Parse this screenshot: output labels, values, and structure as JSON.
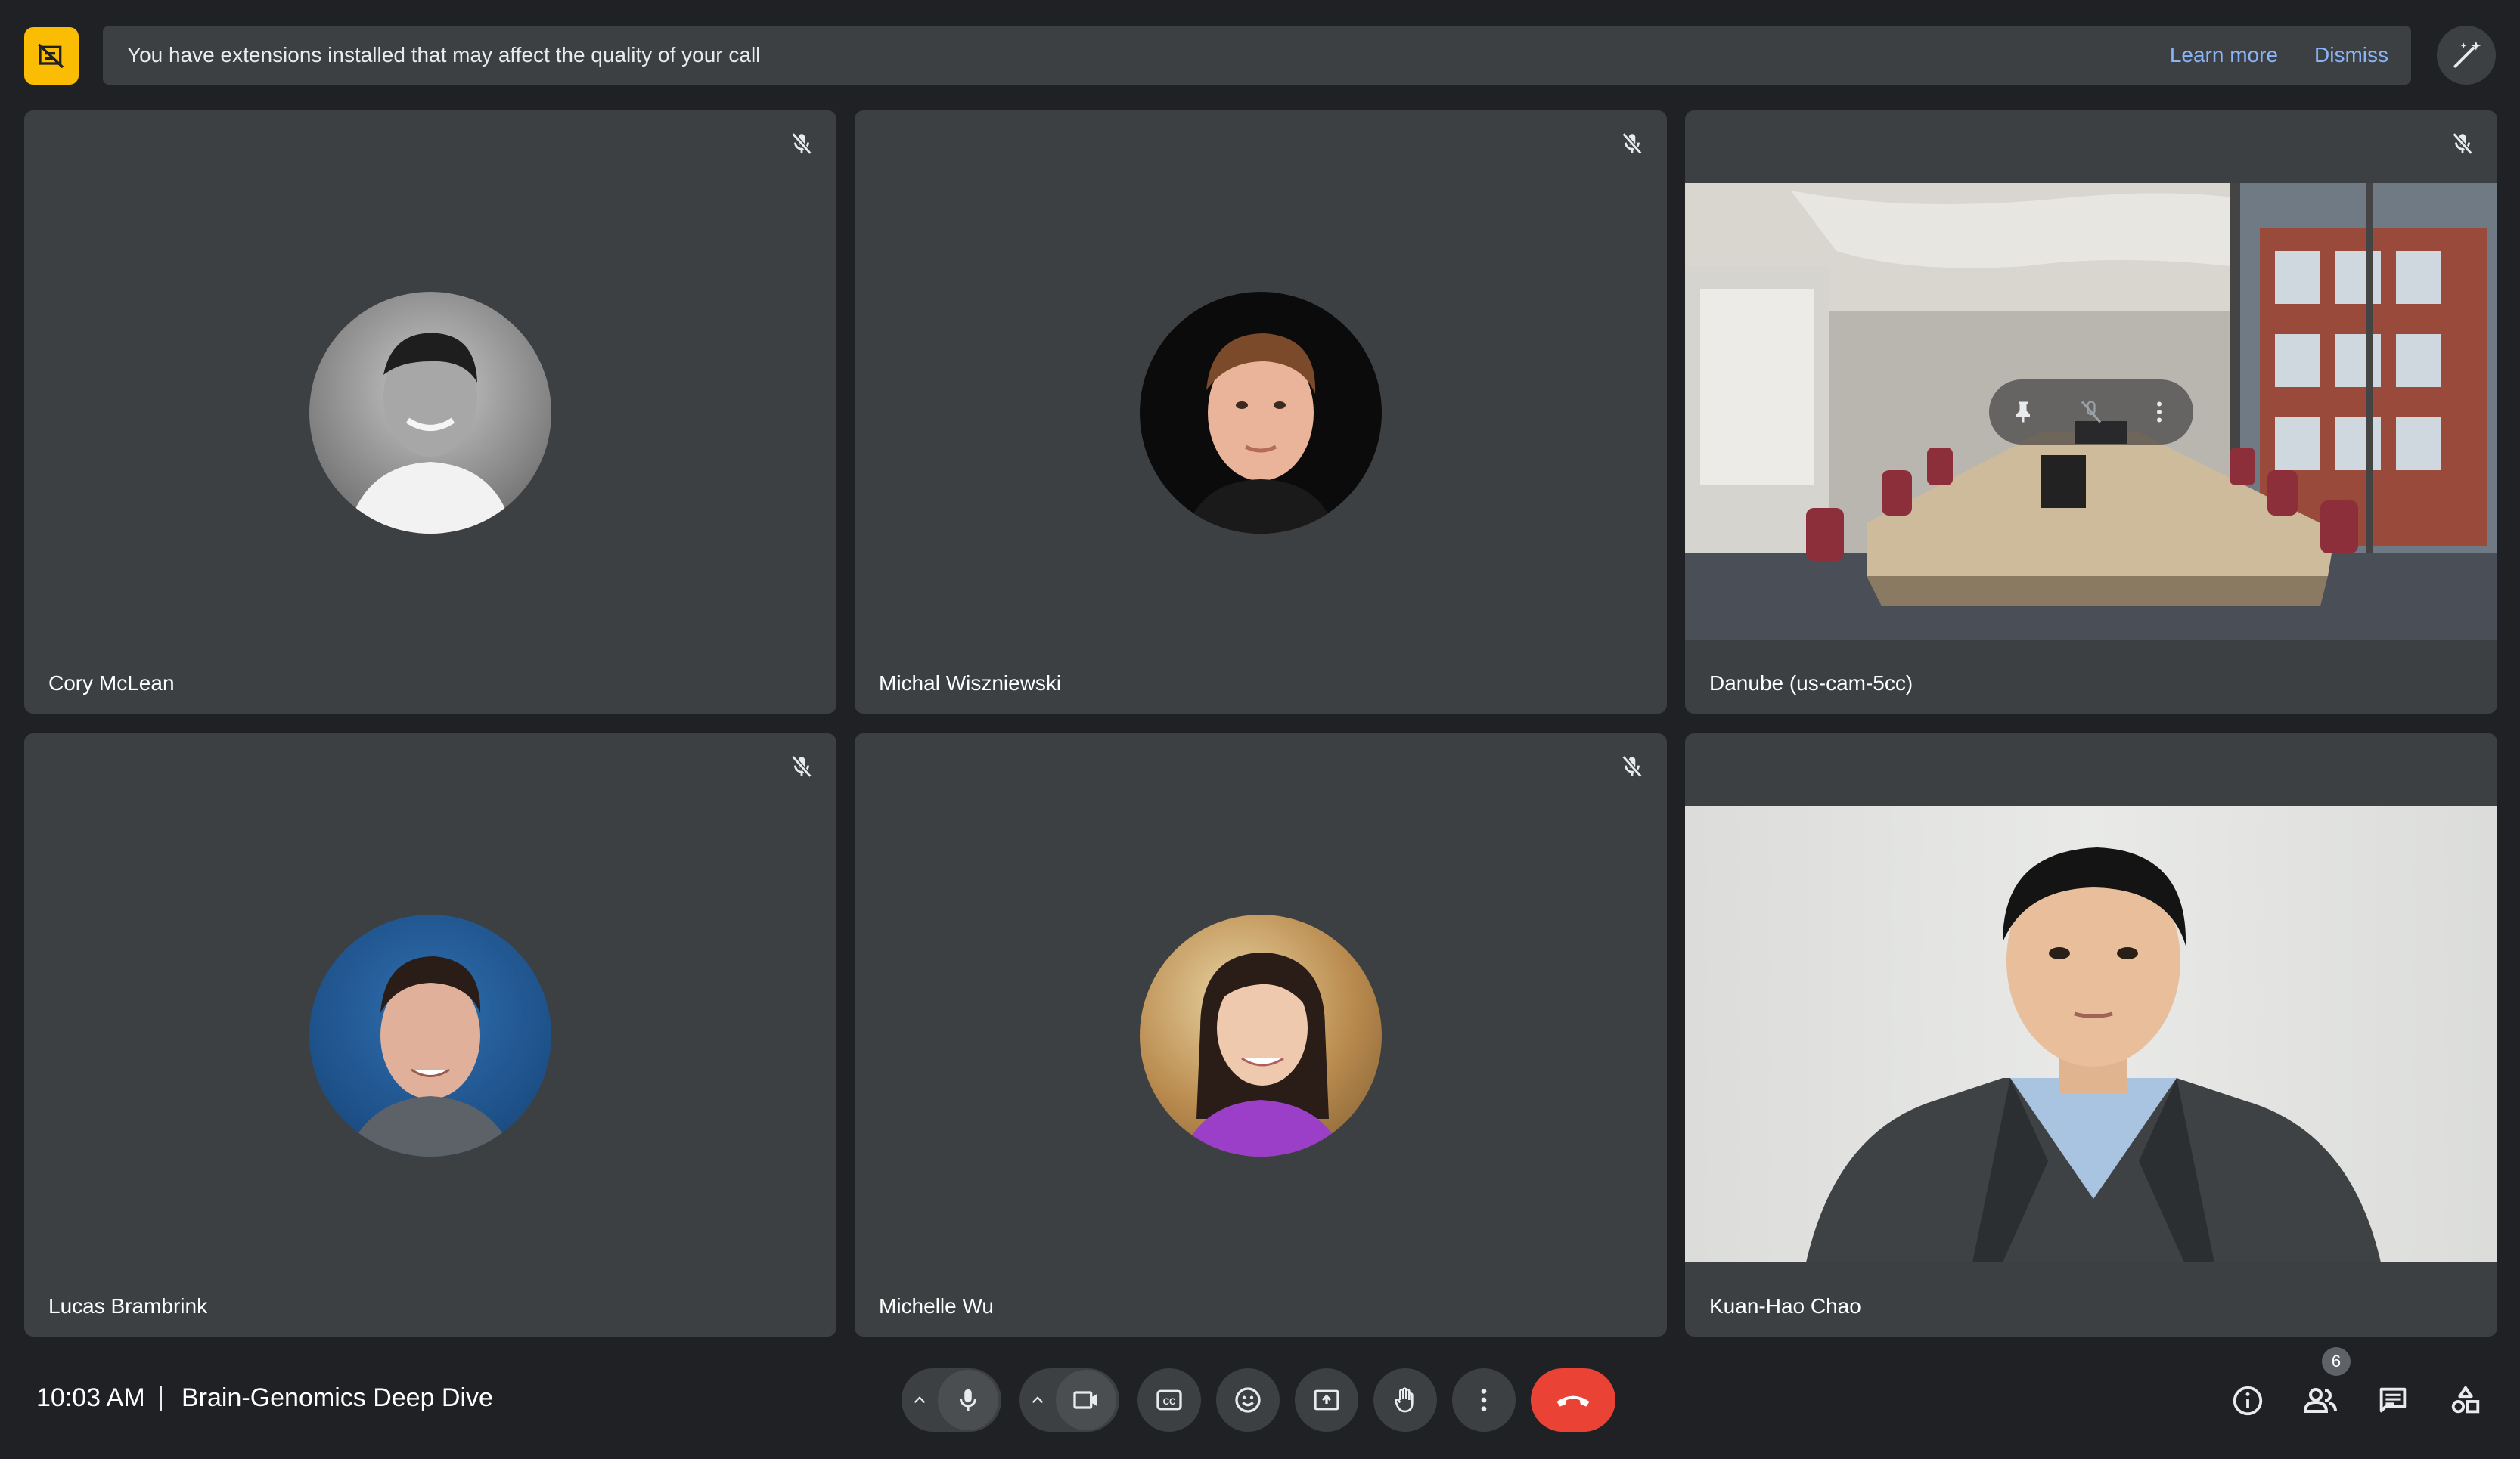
{
  "banner": {
    "icon": "extension-warning-icon",
    "message": "You have extensions installed that may affect the quality of your call",
    "learn_more": "Learn more",
    "dismiss": "Dismiss",
    "effects_icon": "visual-effects-icon"
  },
  "participants": [
    {
      "name": "Cory McLean",
      "muted": true,
      "media": "avatar-photo"
    },
    {
      "name": "Michal Wiszniewski",
      "muted": true,
      "media": "avatar-photo"
    },
    {
      "name": "Danube (us-cam-5cc)",
      "muted": true,
      "media": "conference-room-video"
    },
    {
      "name": "Lucas Brambrink",
      "muted": true,
      "media": "avatar-photo"
    },
    {
      "name": "Michelle Wu",
      "muted": true,
      "media": "avatar-photo"
    },
    {
      "name": "Kuan-Hao Chao",
      "muted": false,
      "media": "live-video"
    }
  ],
  "meeting": {
    "time": "10:03 AM",
    "title": "Brain-Genomics Deep Dive"
  },
  "people_count": "6",
  "colors": {
    "background": "#202124",
    "tile": "#3c4043",
    "accent_link": "#8ab4f8",
    "warning": "#fbbc04",
    "end_call": "#ea4335"
  }
}
